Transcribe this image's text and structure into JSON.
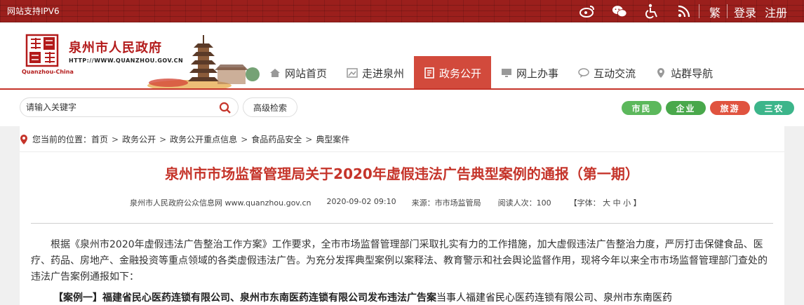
{
  "topbar": {
    "ipv6": "网站支持IPV6",
    "traditional": "繁",
    "login": "登录",
    "register": "注册",
    "icons": [
      "weibo-icon",
      "wechat-icon",
      "accessibility-icon",
      "wifi-icon"
    ]
  },
  "logo": {
    "title": "泉州市人民政府",
    "url": "HTTP://WWW.QUANZHOU.GOV.CN",
    "pinyin": "Quanzhou-China"
  },
  "nav": {
    "items": [
      {
        "label": "网站首页",
        "icon": "home-icon"
      },
      {
        "label": "走进泉州",
        "icon": "picture-icon"
      },
      {
        "label": "政务公开",
        "icon": "document-icon",
        "active": true
      },
      {
        "label": "网上办事",
        "icon": "monitor-icon"
      },
      {
        "label": "互动交流",
        "icon": "chat-icon"
      },
      {
        "label": "站群导航",
        "icon": "location-icon"
      }
    ]
  },
  "search": {
    "placeholder": "请输入关键字",
    "advanced_label": "高级检索"
  },
  "pills": [
    {
      "label": "市民",
      "color": "#5cb85c"
    },
    {
      "label": "企业",
      "color": "#49a84b"
    },
    {
      "label": "旅游",
      "color": "#e0533f"
    },
    {
      "label": "三农",
      "color": "#3cb58a"
    }
  ],
  "breadcrumb": {
    "prefix": "您当前的位置：",
    "items": [
      "首页",
      "政务公开",
      "政务公开重点信息",
      "食品药品安全",
      "典型案件"
    ]
  },
  "article": {
    "title": "泉州市市场监督管理局关于2020年虚假违法广告典型案例的通报（第一期）",
    "source_site": "泉州市人民政府公众信息网 www.quanzhou.gov.cn",
    "date": "2020-09-02 09:10",
    "source": "来源：市市场监管局",
    "views": "阅读人次：100",
    "font_size": "【字体： 大 中 小 】",
    "paragraph1": "根据《泉州市2020年虚假违法广告整治工作方案》工作要求，全市市场监督管理部门采取扎实有力的工作措施，加大虚假违法广告整治力度，严厉打击保健食品、医疗、药品、房地产、金融投资等重点领域的各类虚假违法广告。为充分发挥典型案例以案释法、教育警示和社会舆论监督作用，现将今年以来全市市场监督管理部门查处的违法广告案例通报如下：",
    "case_label": "【案例一】福建省民心医药连锁有限公司、泉州市东南医药连锁有限公司发布违法广告案",
    "case_text": "当事人福建省民心医药连锁有限公司、泉州市东南医药"
  },
  "colors": {
    "brand_red": "#c5342a",
    "topbar_red": "#9b1f1c",
    "nav_active": "#d24a3c"
  }
}
